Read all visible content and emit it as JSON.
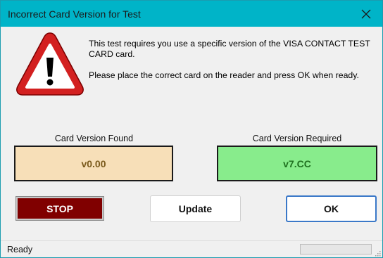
{
  "window": {
    "title": "Incorrect Card Version for Test",
    "title_bar_color": "#00b4c8"
  },
  "message": {
    "line1": "This test requires you use a specific version of the VISA CONTACT TEST CARD card.",
    "line2": "Please place the correct card on the reader and press OK when ready."
  },
  "card_found": {
    "label": "Card Version Found",
    "value": "v0.00",
    "color": "#f7dfb8"
  },
  "card_required": {
    "label": "Card Version Required",
    "value": "v7.CC",
    "color": "#88ec8c"
  },
  "buttons": {
    "stop_label": "STOP",
    "stop_color": "#800000",
    "update_label": "Update",
    "ok_label": "OK"
  },
  "status": {
    "text": "Ready",
    "progress": 0
  },
  "icons": {
    "warning": "warning-triangle-icon",
    "close": "close-icon",
    "grip": "resize-grip-icon"
  }
}
